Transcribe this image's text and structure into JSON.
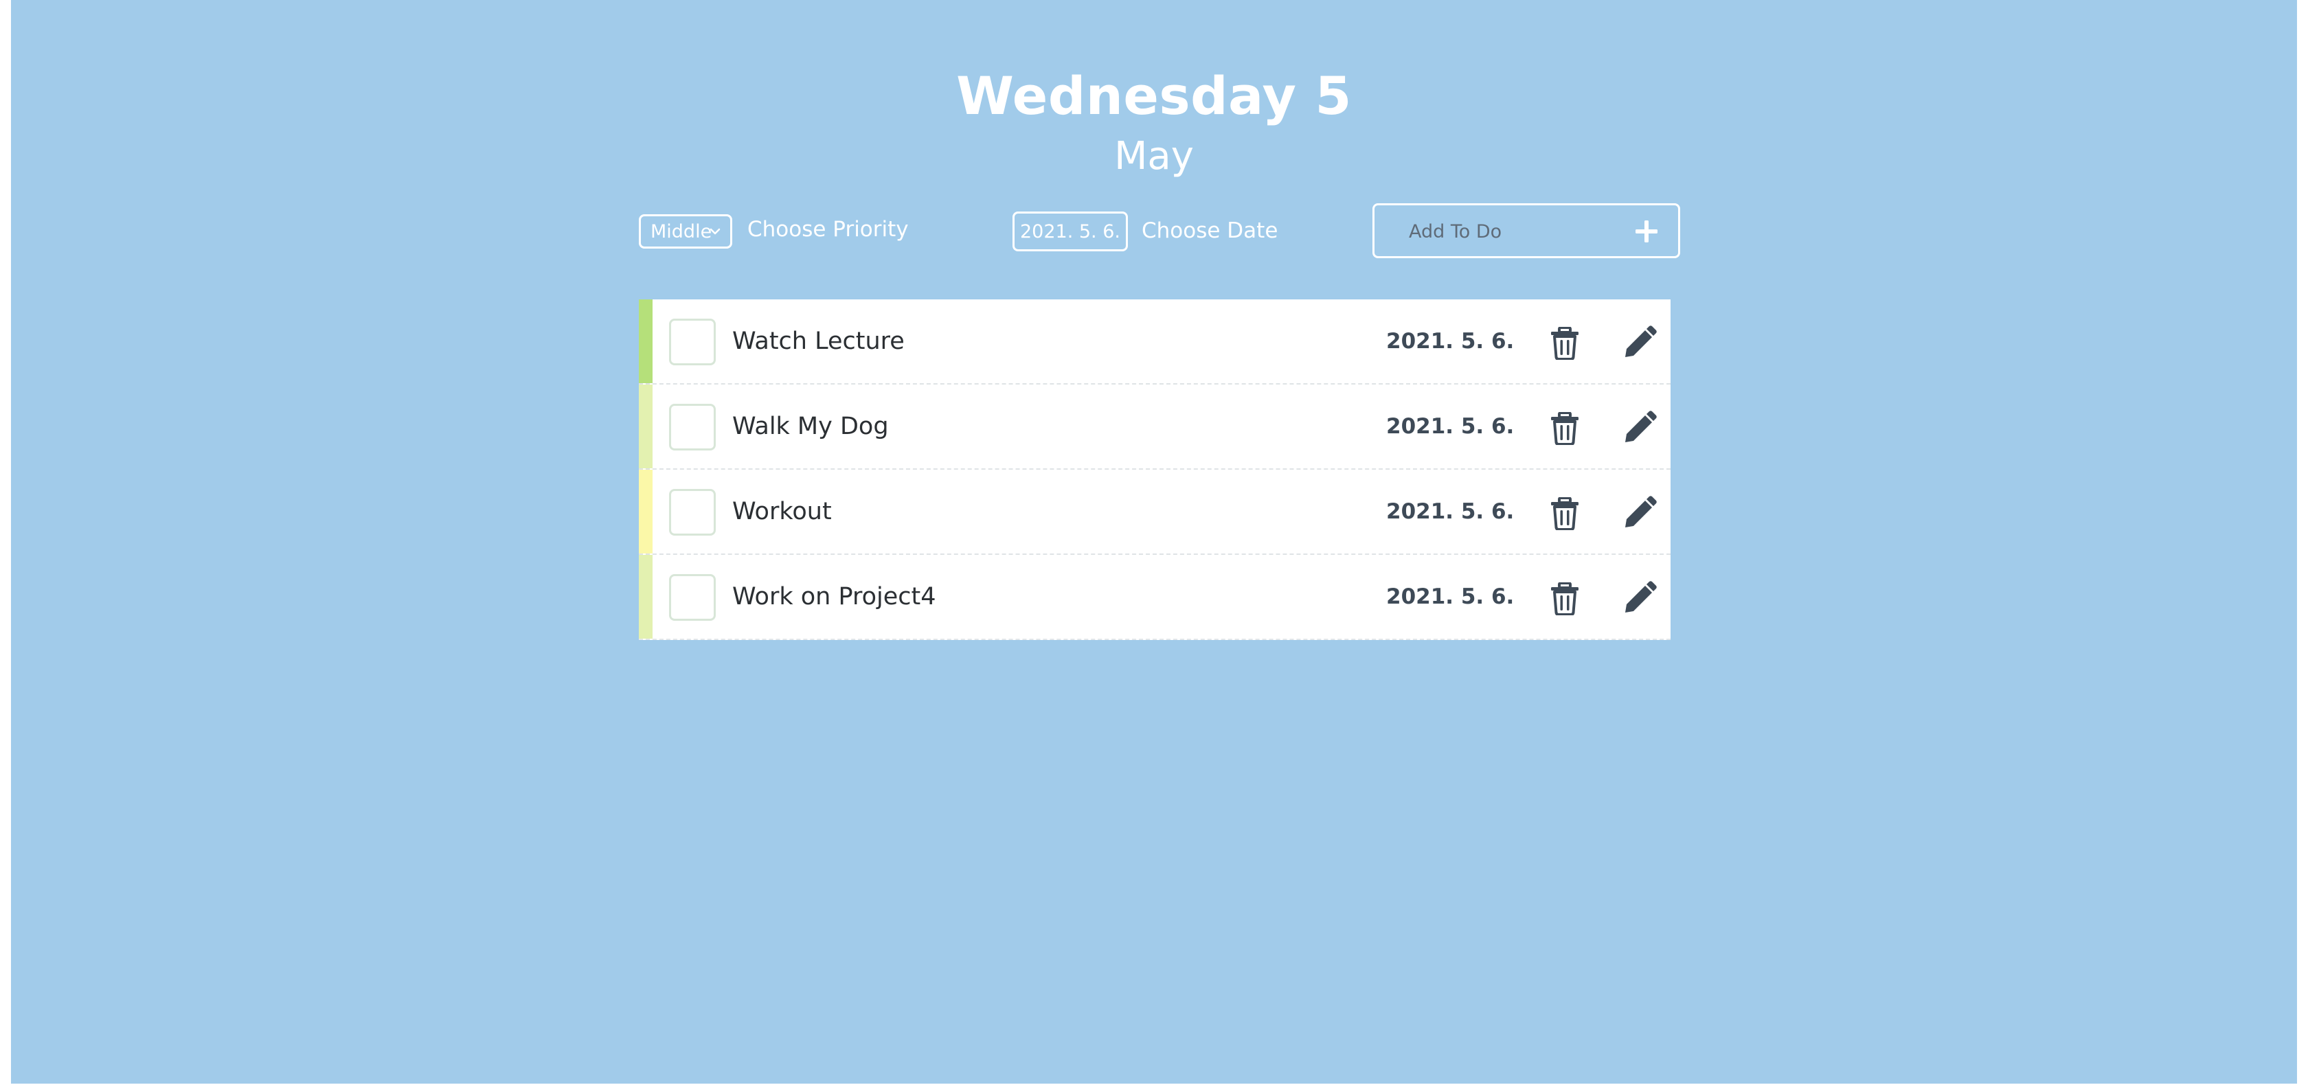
{
  "header": {
    "day": "Wednesday 5",
    "month": "May"
  },
  "controls": {
    "priority_value": "Middle",
    "priority_label": "Choose Priority",
    "date_value": "2021. 5. 6.",
    "date_label": "Choose Date",
    "add_placeholder": "Add To Do",
    "add_icon": "plus-icon"
  },
  "todos": [
    {
      "title": "Watch Lecture",
      "date": "2021. 5. 6.",
      "priority_color": "#b5e07a"
    },
    {
      "title": "Walk My Dog",
      "date": "2021. 5. 6.",
      "priority_color": "#e3f1b0"
    },
    {
      "title": "Workout",
      "date": "2021. 5. 6.",
      "priority_color": "#fbf8a8"
    },
    {
      "title": "Work on Project4",
      "date": "2021. 5. 6.",
      "priority_color": "#e3f1b0"
    }
  ],
  "icons": {
    "delete": "trash-icon",
    "edit": "pencil-icon"
  },
  "colors": {
    "background": "#a1cbea",
    "text_dark": "#3e4a57"
  }
}
